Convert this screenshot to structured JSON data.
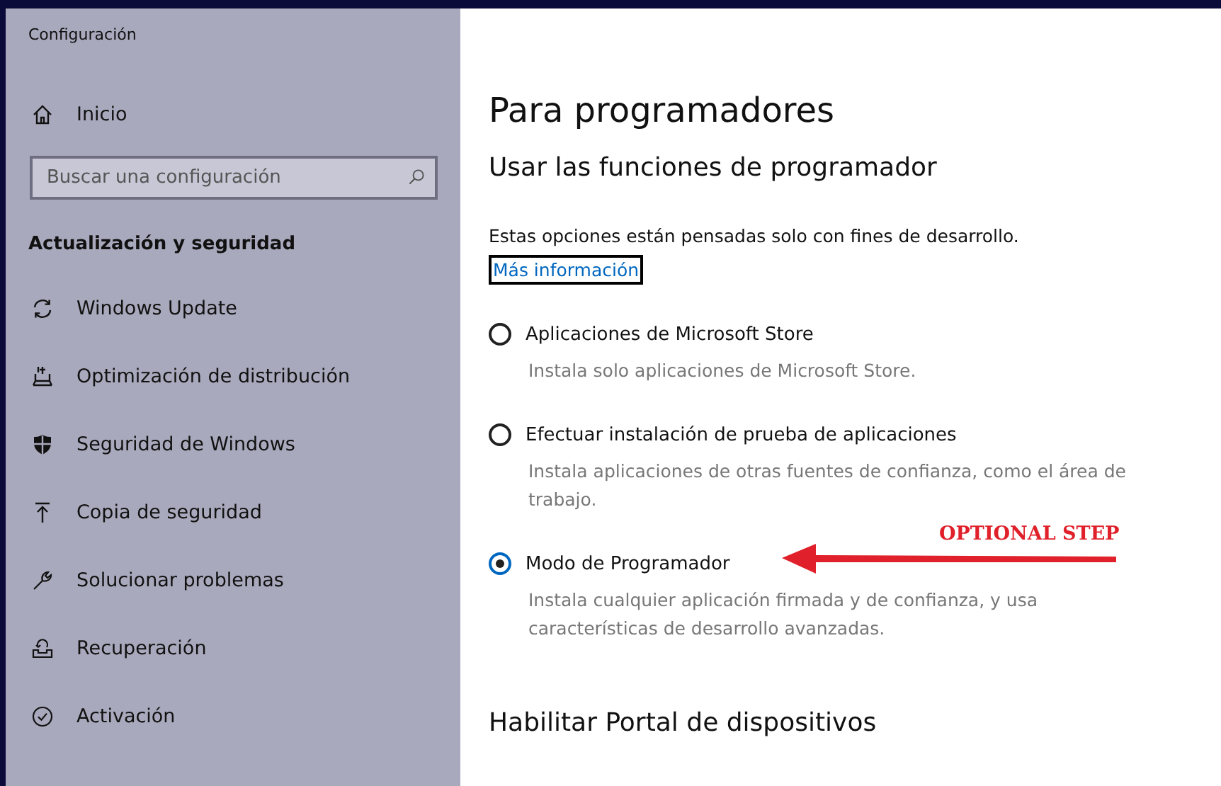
{
  "window": {
    "title": "Configuración"
  },
  "sidebar": {
    "home": "Inicio",
    "search": {
      "placeholder": "Buscar una configuración"
    },
    "section": "Actualización y seguridad",
    "items": [
      {
        "label": "Windows Update"
      },
      {
        "label": "Optimización de distribución"
      },
      {
        "label": "Seguridad de Windows"
      },
      {
        "label": "Copia de seguridad"
      },
      {
        "label": "Solucionar problemas"
      },
      {
        "label": "Recuperación"
      },
      {
        "label": "Activación"
      }
    ]
  },
  "main": {
    "title": "Para programadores",
    "section": "Usar las funciones de programador",
    "description": "Estas opciones están pensadas solo con fines de desarrollo.",
    "link": "Más información",
    "options": [
      {
        "label": "Aplicaciones de Microsoft Store",
        "description": "Instala solo aplicaciones de Microsoft Store.",
        "selected": false
      },
      {
        "label": "Efectuar instalación de prueba de aplicaciones",
        "description": "Instala aplicaciones de otras fuentes de confianza, como el área de trabajo.",
        "selected": false
      },
      {
        "label": "Modo de Programador",
        "description": "Instala cualquier aplicación firmada y de confianza, y usa características de desarrollo avanzadas.",
        "selected": true
      }
    ],
    "section2": "Habilitar Portal de dispositivos"
  },
  "annotation": {
    "text": "OPTIONAL STEP"
  }
}
